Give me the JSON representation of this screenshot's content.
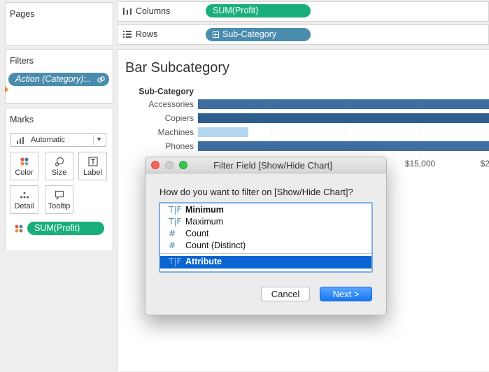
{
  "cards": {
    "pages_title": "Pages",
    "filters_title": "Filters",
    "marks_title": "Marks"
  },
  "filters": {
    "pill_label": "Action (Category):.."
  },
  "marks": {
    "type": "Automatic",
    "buttons": {
      "color": "Color",
      "size": "Size",
      "label": "Label",
      "detail": "Detail",
      "tooltip": "Tooltip"
    },
    "pill": "SUM(Profit)"
  },
  "shelves": {
    "columns_label": "Columns",
    "columns_pill": "SUM(Profit)",
    "rows_label": "Rows",
    "rows_pill": "Sub-Category"
  },
  "colors": {
    "measure_green": "#1aaf7a",
    "dimension_blue": "#4a8cad",
    "bar_dark": "#2e5e8e",
    "bar_mid": "#3f6f9f",
    "bar_light": "#b4d6ef",
    "selection_blue": "#0a64d2"
  },
  "chart_data": {
    "type": "bar",
    "orientation": "horizontal",
    "title": "Bar Subcategory",
    "row_header": "Sub-Category",
    "categories": [
      "Accessories",
      "Copiers",
      "Machines",
      "Phones"
    ],
    "values": [
      41900,
      55600,
      3400,
      44500
    ],
    "x_ticks_visible": [
      "$15,000",
      "$2"
    ],
    "xlim": [
      0,
      19700
    ],
    "grid": true
  },
  "dialog": {
    "title": "Filter Field [Show/Hide Chart]",
    "question": "How do you want to filter on [Show/Hide Chart]?",
    "options": [
      {
        "glyph": "T|F",
        "label": "Minimum"
      },
      {
        "glyph": "T|F",
        "label": "Maximum"
      },
      {
        "glyph": "#",
        "label": "Count"
      },
      {
        "glyph": "#",
        "label": "Count (Distinct)"
      }
    ],
    "selected_option": {
      "glyph": "T|F",
      "label": "Attribute"
    },
    "cancel_label": "Cancel",
    "next_label": "Next >"
  }
}
